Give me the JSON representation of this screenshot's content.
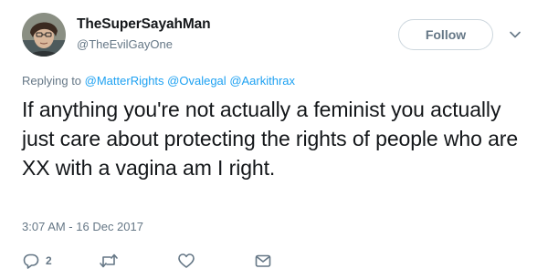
{
  "user": {
    "display_name": "TheSuperSayahMan",
    "handle": "@TheEvilGayOne",
    "avatar_icon": "profile-photo"
  },
  "follow": {
    "label": "Follow",
    "caret_icon": "chevron-down-icon"
  },
  "reply_context": {
    "prefix": "Replying to ",
    "mentions": [
      "@MatterRights",
      "@Ovalegal",
      "@Aarkithrax"
    ]
  },
  "tweet": {
    "text": "If anything you're not actually a feminist you actually just care about protecting the rights of people who are XX with a vagina am I right.",
    "timestamp": "3:07 AM - 16 Dec 2017"
  },
  "actions": {
    "reply": {
      "icon": "reply-icon",
      "count": "2"
    },
    "retweet": {
      "icon": "retweet-icon"
    },
    "like": {
      "icon": "heart-icon"
    },
    "dm": {
      "icon": "envelope-icon"
    }
  },
  "colors": {
    "text": "#14171a",
    "secondary": "#657786",
    "link": "#1da1f2",
    "border": "#ccd6dd"
  }
}
